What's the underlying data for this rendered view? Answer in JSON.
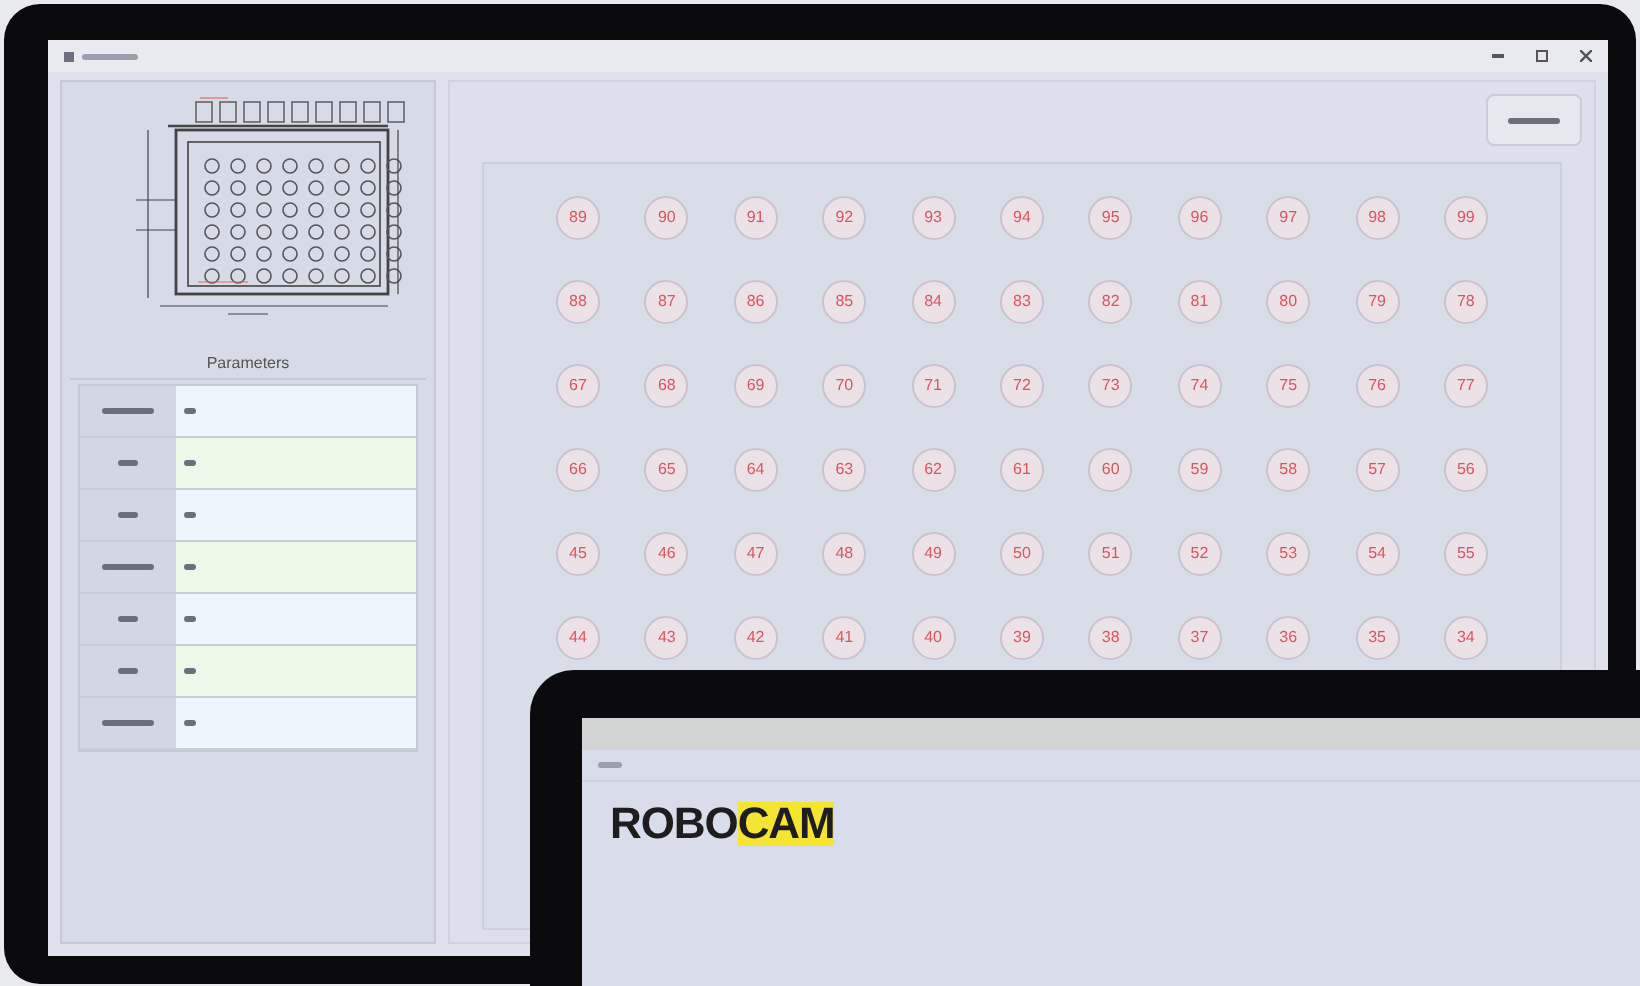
{
  "parameters": {
    "title": "Parameters"
  },
  "well_grid": {
    "rows": [
      [
        "89",
        "90",
        "91",
        "92",
        "93",
        "94",
        "95",
        "96",
        "97",
        "98",
        "99"
      ],
      [
        "88",
        "87",
        "86",
        "85",
        "84",
        "83",
        "82",
        "81",
        "80",
        "79",
        "78"
      ],
      [
        "67",
        "68",
        "69",
        "70",
        "71",
        "72",
        "73",
        "74",
        "75",
        "76",
        "77"
      ],
      [
        "66",
        "65",
        "64",
        "63",
        "62",
        "61",
        "60",
        "59",
        "58",
        "57",
        "56"
      ],
      [
        "45",
        "46",
        "47",
        "48",
        "49",
        "50",
        "51",
        "52",
        "53",
        "54",
        "55"
      ],
      [
        "44",
        "43",
        "42",
        "41",
        "40",
        "39",
        "38",
        "37",
        "36",
        "35",
        "34"
      ]
    ]
  },
  "second_window": {
    "logo": {
      "dark": "ROBO",
      "highlight": "CAM"
    }
  }
}
